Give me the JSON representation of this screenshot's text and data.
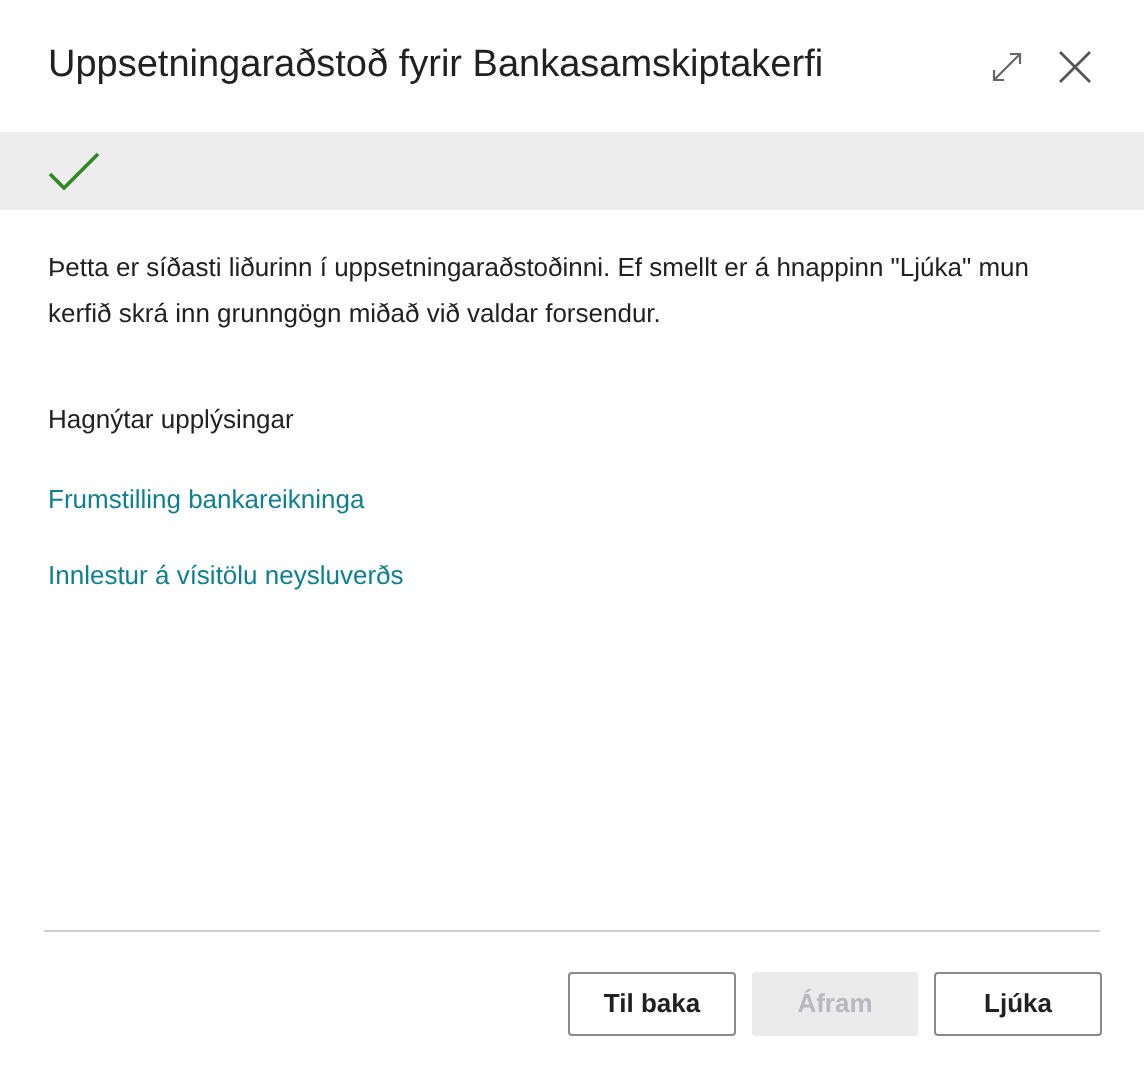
{
  "window": {
    "title": "Uppsetningaraðstoð fyrir Bankasamskiptakerfi"
  },
  "status": {
    "completed": true
  },
  "intro": "Þetta er síðasti liðurinn í uppsetningaraðstoðinni. Ef smellt er á hnappinn \"Ljúka\" mun kerfið skrá inn grunngögn miðað við valdar forsendur.",
  "section_heading": "Hagnýtar upplýsingar",
  "links": [
    "Frumstilling bankareikninga",
    "Innlestur á vísitölu neysluverðs"
  ],
  "buttons": [
    {
      "label": "Til baka",
      "disabled": false
    },
    {
      "label": "Áfram",
      "disabled": true
    },
    {
      "label": "Ljúka",
      "disabled": false
    }
  ]
}
